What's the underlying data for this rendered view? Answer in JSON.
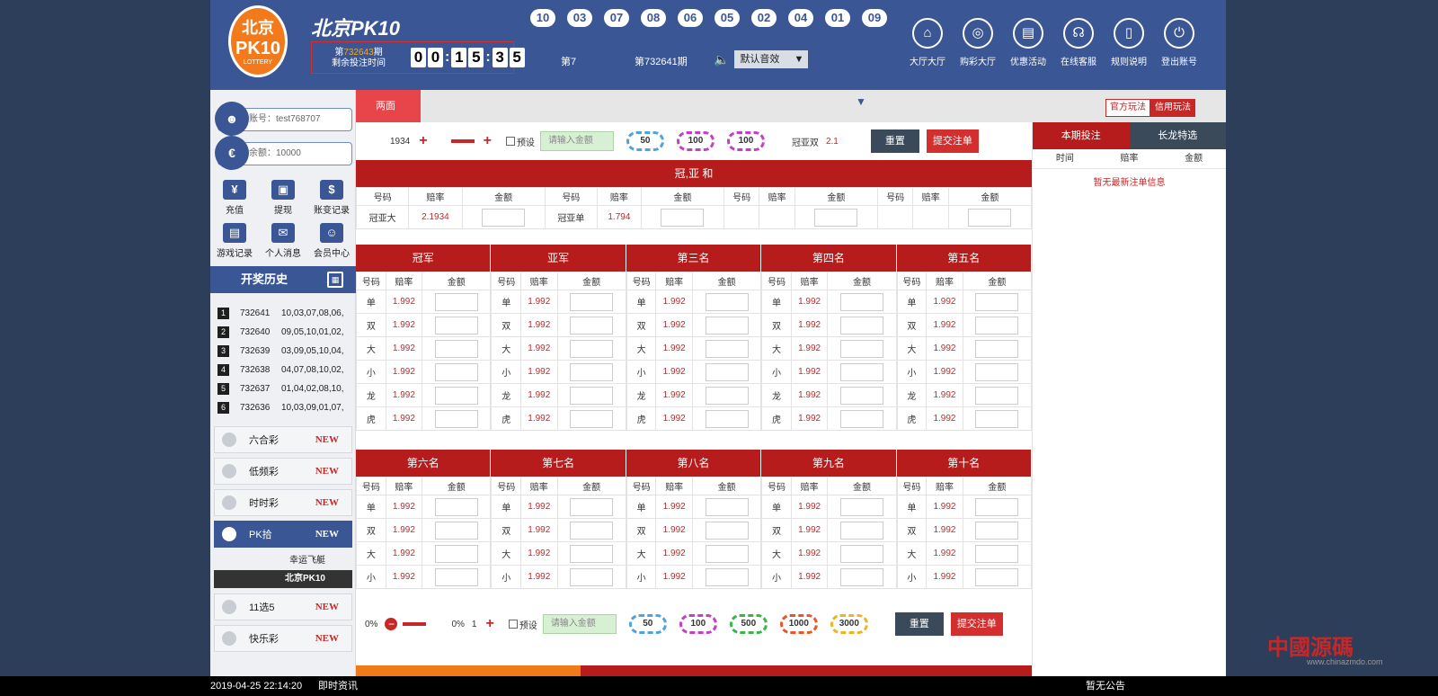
{
  "header": {
    "logo_line1": "北京",
    "logo_line2": "PK10",
    "logo_line3": "LOTTERY",
    "brand": "北京PK10",
    "issue_prefix": "第",
    "issue_number": "732643",
    "issue_suffix": "期",
    "remain_label": "剩余投注时间",
    "countdown": [
      "0",
      "0",
      "1",
      "5",
      "3",
      "5"
    ],
    "latest_balls": [
      "10",
      "03",
      "07",
      "08",
      "06",
      "05",
      "02",
      "04",
      "01",
      "09"
    ],
    "current_no": "第7",
    "prev_no": "第732641期",
    "sound_value": "默认音效",
    "nav": [
      {
        "label": "大厅大厅",
        "icon": "home-icon",
        "glyph": "⌂"
      },
      {
        "label": "购彩大厅",
        "icon": "target-icon",
        "glyph": "◎"
      },
      {
        "label": "优惠活动",
        "icon": "doc-icon",
        "glyph": "▤"
      },
      {
        "label": "在线客服",
        "icon": "headset-icon",
        "glyph": "☊"
      },
      {
        "label": "规则说明",
        "icon": "phone-icon",
        "glyph": "▯"
      },
      {
        "label": "登出账号",
        "icon": "power-icon",
        "glyph": "⏻"
      }
    ]
  },
  "sidebar": {
    "account": "账号：test768707",
    "balance": "余额：10000",
    "quick": [
      {
        "label": "充值",
        "glyph": "¥",
        "icon": "yen-icon"
      },
      {
        "label": "提现",
        "glyph": "▣",
        "icon": "wallet-icon"
      },
      {
        "label": "账变记录",
        "glyph": "$",
        "icon": "ledger-icon"
      },
      {
        "label": "游戏记录",
        "glyph": "▤",
        "icon": "record-icon"
      },
      {
        "label": "个人消息",
        "glyph": "✉",
        "icon": "message-icon"
      },
      {
        "label": "会员中心",
        "glyph": "☺",
        "icon": "member-icon"
      }
    ],
    "history_title": "开奖历史",
    "history": [
      {
        "idx": "1",
        "period": "732641",
        "nums": "10,03,07,08,06,"
      },
      {
        "idx": "2",
        "period": "732640",
        "nums": "09,05,10,01,02,"
      },
      {
        "idx": "3",
        "period": "732639",
        "nums": "03,09,05,10,04,"
      },
      {
        "idx": "4",
        "period": "732638",
        "nums": "04,07,08,10,02,"
      },
      {
        "idx": "5",
        "period": "732637",
        "nums": "01,04,02,08,10,"
      },
      {
        "idx": "6",
        "period": "732636",
        "nums": "10,03,09,01,07,"
      }
    ],
    "lotteries": [
      {
        "label": "六合彩",
        "new": "NEW"
      },
      {
        "label": "低频彩",
        "new": "NEW"
      },
      {
        "label": "时时彩",
        "new": "NEW"
      },
      {
        "label": "PK拾",
        "new": "NEW"
      }
    ],
    "sub_items": [
      "幸运飞艇",
      "北京PK10"
    ],
    "lotteries2": [
      {
        "label": "11选5",
        "new": "NEW"
      },
      {
        "label": "快乐彩",
        "new": "NEW"
      }
    ]
  },
  "main": {
    "tab_active": "两面",
    "play_official": "官方玩法",
    "play_credit": "信用玩法",
    "toolbar_top": {
      "pct": "1934",
      "preset": "预设",
      "amount_placeholder": "请输入金额",
      "chips": [
        "50",
        "100",
        "100"
      ],
      "reset": "重置",
      "submit": "提交注单",
      "extra_label": "冠亚双",
      "extra_odds": "2.1"
    },
    "toolbar_bottom": {
      "pct_left": "0%",
      "pct_right": "0%",
      "pct_val": "1",
      "preset": "预设",
      "amount_placeholder": "请输入金额",
      "chips": [
        "50",
        "100",
        "500",
        "1000",
        "3000"
      ],
      "reset": "重置",
      "submit": "提交注单"
    },
    "sum_title": "冠,亚 和",
    "col_code": "号码",
    "col_odds": "赔率",
    "col_amount": "金额",
    "sum_rows": [
      {
        "code": "冠亚大",
        "odds": "2.1934"
      },
      {
        "code": "冠亚单",
        "odds": "1.794"
      }
    ],
    "groupA_titles": [
      "冠军",
      "亚军",
      "第三名",
      "第四名",
      "第五名"
    ],
    "groupB_titles": [
      "第六名",
      "第七名",
      "第八名",
      "第九名",
      "第十名"
    ],
    "rowsA": [
      "单",
      "双",
      "大",
      "小",
      "龙",
      "虎"
    ],
    "rowsB": [
      "单",
      "双",
      "大",
      "小"
    ],
    "odds": "1.992"
  },
  "right": {
    "tab1": "本期投注",
    "tab2": "长龙特选",
    "cols": [
      "时间",
      "赔率",
      "金额"
    ],
    "empty": "暂无最新注单信息"
  },
  "bottom": {
    "time": "2019-04-25 22:14:20",
    "news": "即时资讯",
    "notice": "暂无公告"
  },
  "watermark": {
    "text": "中國源碼",
    "sub": "www.chinazmdo.com"
  },
  "colors": {
    "header": "#3a5694",
    "accent": "#b71c1c",
    "odds": "#c62828"
  }
}
